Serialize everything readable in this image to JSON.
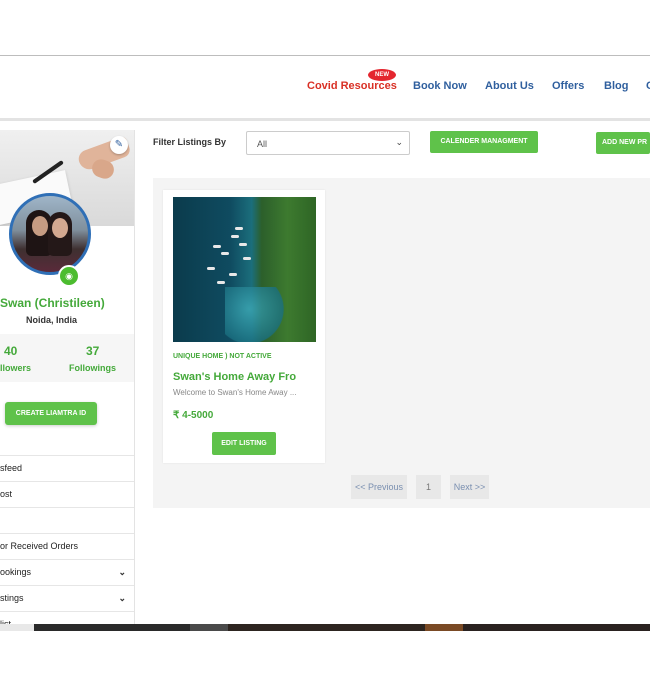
{
  "nav": {
    "covid": "Covid Resources",
    "new_badge": "NEW",
    "book_now": "Book Now",
    "about_us": "About Us",
    "offers": "Offers",
    "blog": "Blog",
    "overflow": "C"
  },
  "profile": {
    "name": "Swan (Christileen)",
    "location": "Noida, India",
    "followers_count": "40",
    "followers_label": "llowers",
    "followings_count": "37",
    "followings_label": "Followings",
    "create_button": "CREATE LIAMTRA ID"
  },
  "menu": [
    {
      "label": "sfeed",
      "chevron": ""
    },
    {
      "label": "ost",
      "chevron": ""
    },
    {
      "label": "",
      "chevron": ""
    },
    {
      "label": "or Received Orders",
      "chevron": ""
    },
    {
      "label": "ookings",
      "chevron": "⌄"
    },
    {
      "label": "stings",
      "chevron": "⌄"
    },
    {
      "label": "list",
      "chevron": "⌄"
    }
  ],
  "filter": {
    "label": "Filter Listings By",
    "selected": "All",
    "calendar_button": "CALENDER MANAGMENT",
    "add_button": "ADD NEW PR"
  },
  "listing": {
    "tag": "UNIQUE HOME ) NOT ACTIVE",
    "title": "Swan's Home Away Fro",
    "description": "Welcome to Swan's Home Away ...",
    "price": "₹ 4-5000",
    "edit_button": "EDIT LISTING"
  },
  "pagination": {
    "previous": "<< Previous",
    "page": "1",
    "next": "Next >>"
  },
  "icons": {
    "edit": "pencil-square-icon",
    "camera": "camera-icon",
    "chevron": "chevron-down-icon"
  },
  "colors": {
    "accent_green": "#5fc24a",
    "text_green": "#44a93a",
    "nav_blue": "#2f5f9e",
    "covid_red": "#d93025"
  }
}
